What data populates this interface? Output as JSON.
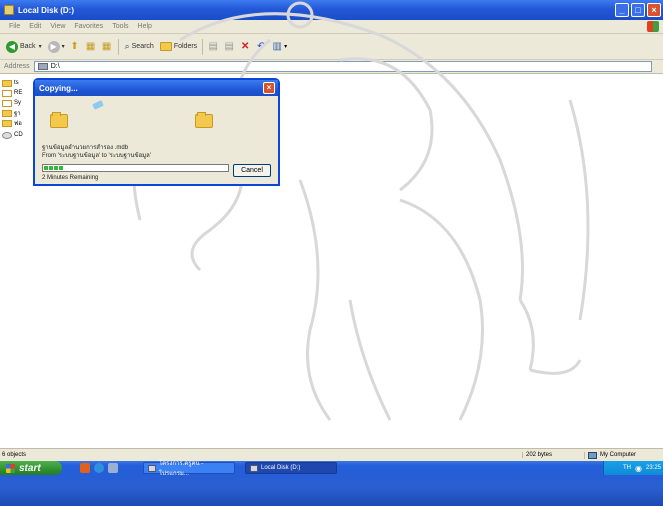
{
  "window": {
    "title": "Local Disk (D:)"
  },
  "menu": {
    "items": [
      "File",
      "Edit",
      "View",
      "Favorites",
      "Tools",
      "Help"
    ]
  },
  "toolbar": {
    "back_label": "Back",
    "search_label": "Search",
    "folders_label": "Folders"
  },
  "address": {
    "label": "Address",
    "value": "D:\\"
  },
  "files": [
    {
      "name": "ts",
      "kind": "folder"
    },
    {
      "name": "RE",
      "kind": "folder"
    },
    {
      "name": "Sy",
      "kind": "folder"
    },
    {
      "name": "ฐา",
      "kind": "folder"
    },
    {
      "name": "ฟอ",
      "kind": "folder"
    },
    {
      "name": "CD",
      "kind": "cd"
    }
  ],
  "dialog": {
    "title": "Copying...",
    "file_name": "ฐานข้อมูลอำนวยการสำรอง .mdb",
    "from_to": "From 'ระบบฐานข้อมูล' to 'ระบบฐานข้อมูล'",
    "progress": 0.1,
    "time_remaining": "2 Minutes Remaining",
    "cancel_label": "Cancel"
  },
  "statusbar": {
    "objects": "6 objects",
    "size": "202 bytes",
    "zone": "My Computer"
  },
  "taskbar": {
    "start_label": "start",
    "tasks": [
      "โครงการ.ครูคน - โปรแกรม...",
      "Local Disk (D:)"
    ],
    "lang": "TH",
    "clock": "23:25"
  },
  "colors": {
    "titlebar": "#2358d8",
    "taskbar": "#245edb",
    "start_button": "#2f912f",
    "progress_fill": "#3cb43c"
  }
}
